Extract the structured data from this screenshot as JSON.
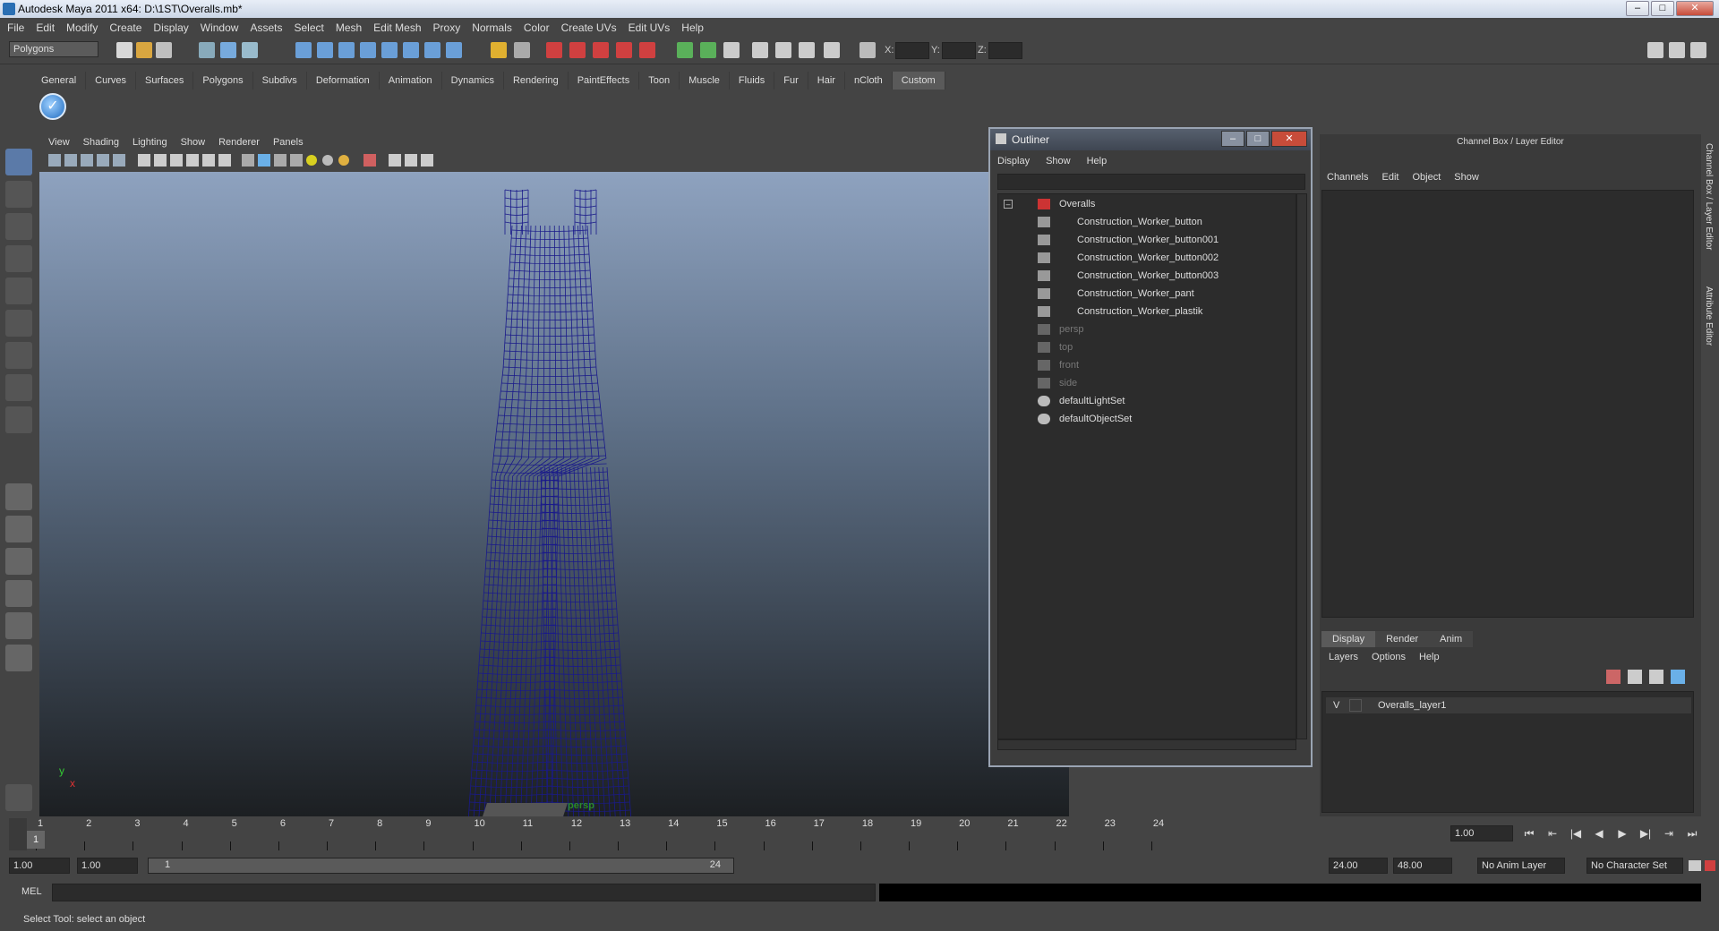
{
  "window": {
    "title": "Autodesk Maya 2011 x64: D:\\1ST\\Overalls.mb*"
  },
  "menubar": [
    "File",
    "Edit",
    "Modify",
    "Create",
    "Display",
    "Window",
    "Assets",
    "Select",
    "Mesh",
    "Edit Mesh",
    "Proxy",
    "Normals",
    "Color",
    "Create UVs",
    "Edit UVs",
    "Help"
  ],
  "statusline": {
    "mode": "Polygons",
    "x_label": "X:",
    "y_label": "Y:",
    "z_label": "Z:"
  },
  "shelf": {
    "tabs": [
      "General",
      "Curves",
      "Surfaces",
      "Polygons",
      "Subdivs",
      "Deformation",
      "Animation",
      "Dynamics",
      "Rendering",
      "PaintEffects",
      "Toon",
      "Muscle",
      "Fluids",
      "Fur",
      "Hair",
      "nCloth",
      "Custom"
    ],
    "active_tab": "Custom"
  },
  "viewport": {
    "menus": [
      "View",
      "Shading",
      "Lighting",
      "Show",
      "Renderer",
      "Panels"
    ],
    "camera_label": "persp",
    "axis_y": "y",
    "axis_x": "x",
    "mesh_color": "#1a1a8a"
  },
  "outliner": {
    "title": "Outliner",
    "menus": [
      "Display",
      "Show",
      "Help"
    ],
    "items": [
      {
        "label": "Overalls",
        "type": "group"
      },
      {
        "label": "Construction_Worker_button",
        "type": "child"
      },
      {
        "label": "Construction_Worker_button001",
        "type": "child"
      },
      {
        "label": "Construction_Worker_button002",
        "type": "child"
      },
      {
        "label": "Construction_Worker_button003",
        "type": "child"
      },
      {
        "label": "Construction_Worker_pant",
        "type": "child"
      },
      {
        "label": "Construction_Worker_plastik",
        "type": "child"
      },
      {
        "label": "persp",
        "type": "camera"
      },
      {
        "label": "top",
        "type": "camera"
      },
      {
        "label": "front",
        "type": "camera"
      },
      {
        "label": "side",
        "type": "camera"
      },
      {
        "label": "defaultLightSet",
        "type": "set"
      },
      {
        "label": "defaultObjectSet",
        "type": "set"
      }
    ]
  },
  "channelbox": {
    "title": "Channel Box / Layer Editor",
    "menus": [
      "Channels",
      "Edit",
      "Object",
      "Show"
    ],
    "layer_tabs": [
      "Display",
      "Render",
      "Anim"
    ],
    "active_layer_tab": "Display",
    "layer_menus": [
      "Layers",
      "Options",
      "Help"
    ],
    "layer": {
      "visible": "V",
      "name": "Overalls_layer1"
    },
    "side_tabs": [
      "Channel Box / Layer Editor",
      "Attribute Editor"
    ]
  },
  "timeline": {
    "ticks": [
      "1",
      "2",
      "3",
      "4",
      "5",
      "6",
      "7",
      "8",
      "9",
      "10",
      "11",
      "12",
      "13",
      "14",
      "15",
      "16",
      "17",
      "18",
      "19",
      "20",
      "21",
      "22",
      "23",
      "24"
    ],
    "current_frame_marker": "1",
    "current_frame": "1.00"
  },
  "range": {
    "start": "1.00",
    "start2": "1.00",
    "slider_start": "1",
    "slider_end": "24",
    "end": "24.00",
    "end2": "48.00",
    "anim_layer": "No Anim Layer",
    "char_set": "No Character Set"
  },
  "command": {
    "label": "MEL"
  },
  "help": {
    "text": "Select Tool: select an object"
  }
}
